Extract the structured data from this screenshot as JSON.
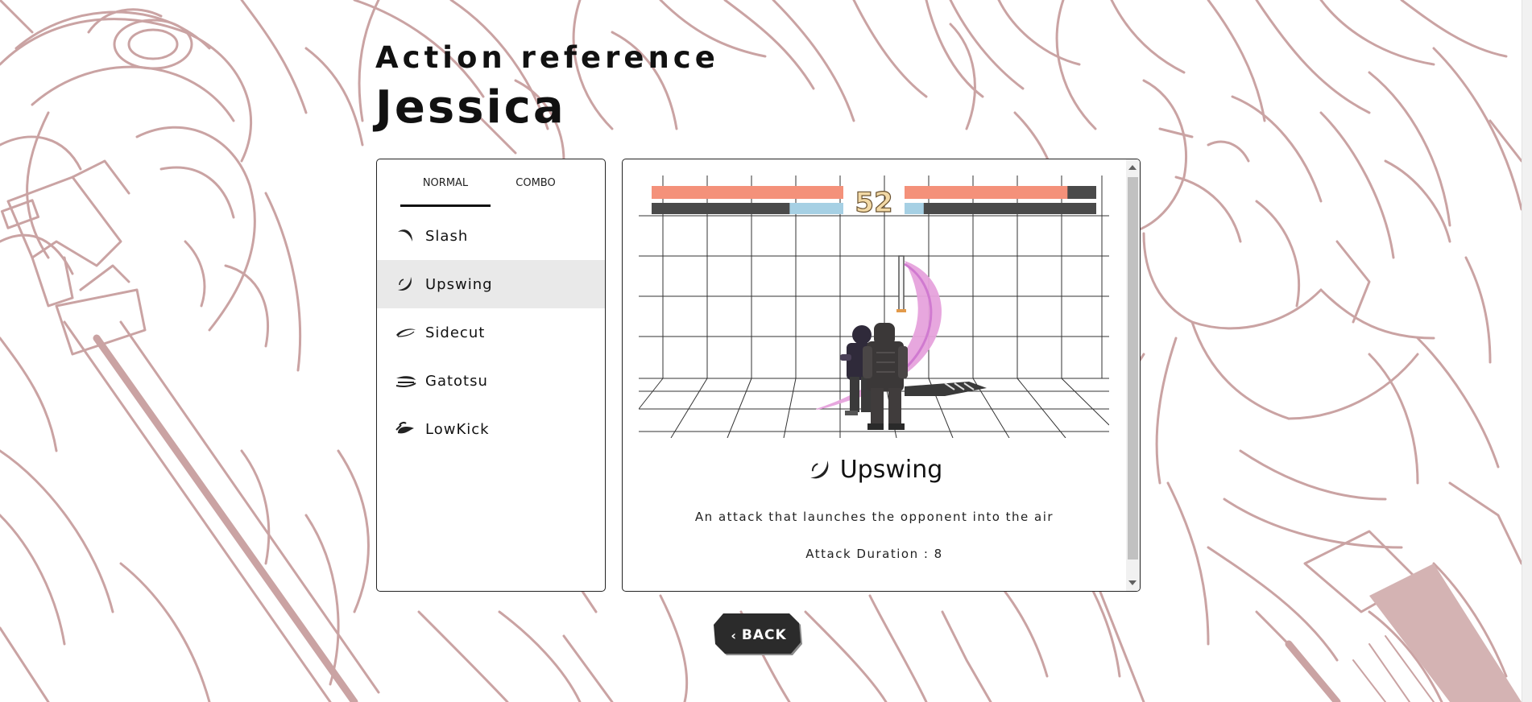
{
  "header": {
    "subtitle": "Action reference",
    "character_name": "Jessica"
  },
  "tabs": [
    {
      "label": "NORMAL",
      "active": true
    },
    {
      "label": "COMBO",
      "active": false
    }
  ],
  "moves": [
    {
      "label": "Slash",
      "icon": "slash-icon",
      "active": false
    },
    {
      "label": "Upswing",
      "icon": "upswing-icon",
      "active": true
    },
    {
      "label": "Sidecut",
      "icon": "sidecut-icon",
      "active": false
    },
    {
      "label": "Gatotsu",
      "icon": "gatotsu-icon",
      "active": false
    },
    {
      "label": "LowKick",
      "icon": "lowkick-icon",
      "active": false
    }
  ],
  "detail": {
    "name": "Upswing",
    "icon": "upswing-icon",
    "description": "An attack that launches the opponent into the air",
    "duration_text": "Attack Duration : 8"
  },
  "preview": {
    "timer": "52",
    "p1_health": 1.0,
    "p2_health": 0.85,
    "p1_meter": 0.28,
    "p2_meter": 0.1
  },
  "back_button": {
    "label": "BACK"
  },
  "colors": {
    "sketch": "#caa3a3",
    "health": "#f4917a",
    "meter": "#a6d0e4",
    "button": "#2b2b2b"
  }
}
